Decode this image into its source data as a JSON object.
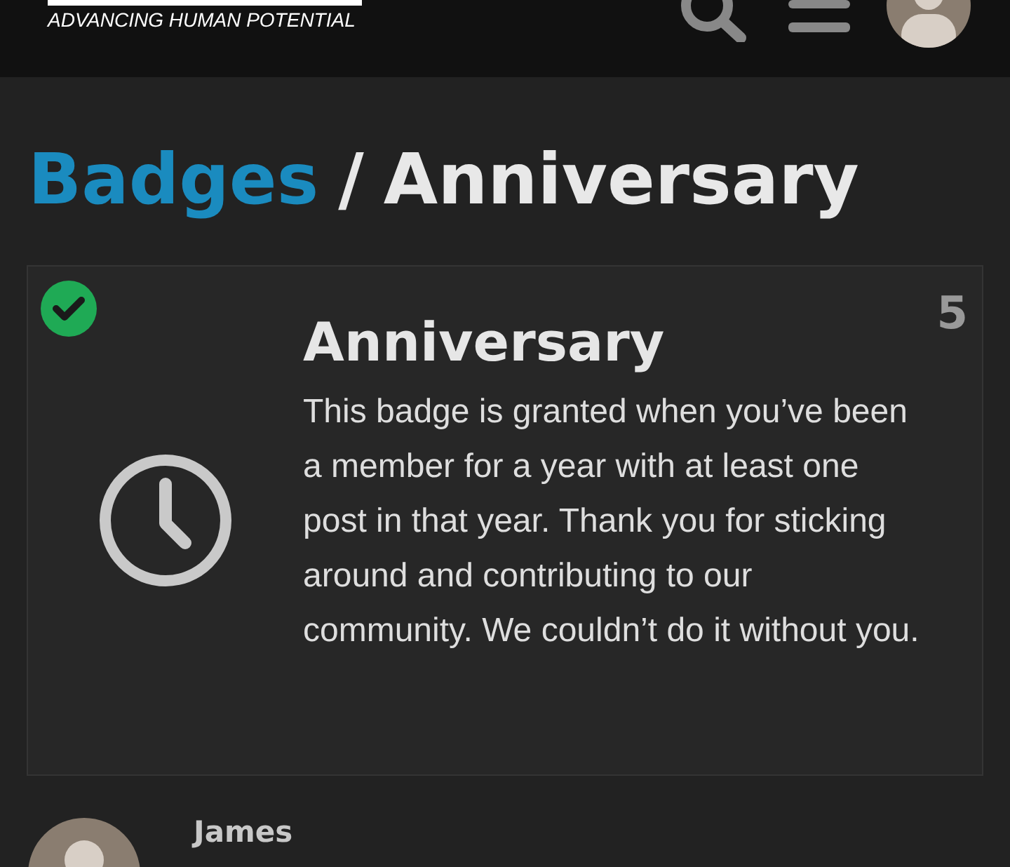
{
  "header": {
    "tagline": "ADVANCING HUMAN POTENTIAL"
  },
  "breadcrumb": {
    "parent": "Badges",
    "separator": "/",
    "current": "Anniversary"
  },
  "badge": {
    "granted": true,
    "count": "5",
    "title": "Anniversary",
    "description": "This badge is granted when you’ve been a member for a year with at least one post in that year. Thank you for sticking around and contributing to our community. We couldn’t do it without you."
  },
  "members": [
    {
      "name": "James"
    }
  ]
}
